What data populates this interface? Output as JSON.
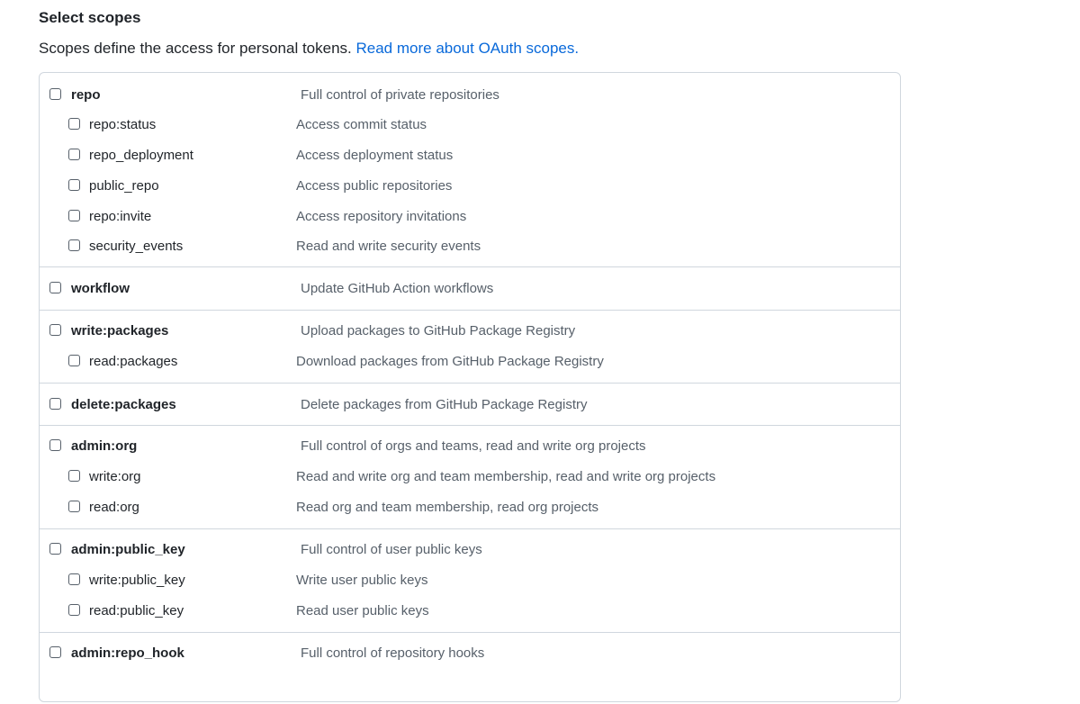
{
  "header": {
    "title": "Select scopes",
    "description": "Scopes define the access for personal tokens.",
    "link": "Read more about OAuth scopes."
  },
  "scopes": [
    {
      "name": "repo",
      "desc": "Full control of private repositories",
      "children": [
        {
          "name": "repo:status",
          "desc": "Access commit status"
        },
        {
          "name": "repo_deployment",
          "desc": "Access deployment status"
        },
        {
          "name": "public_repo",
          "desc": "Access public repositories"
        },
        {
          "name": "repo:invite",
          "desc": "Access repository invitations"
        },
        {
          "name": "security_events",
          "desc": "Read and write security events"
        }
      ]
    },
    {
      "name": "workflow",
      "desc": "Update GitHub Action workflows",
      "children": []
    },
    {
      "name": "write:packages",
      "desc": "Upload packages to GitHub Package Registry",
      "children": [
        {
          "name": "read:packages",
          "desc": "Download packages from GitHub Package Registry"
        }
      ]
    },
    {
      "name": "delete:packages",
      "desc": "Delete packages from GitHub Package Registry",
      "children": []
    },
    {
      "name": "admin:org",
      "desc": "Full control of orgs and teams, read and write org projects",
      "children": [
        {
          "name": "write:org",
          "desc": "Read and write org and team membership, read and write org projects"
        },
        {
          "name": "read:org",
          "desc": "Read org and team membership, read org projects"
        }
      ]
    },
    {
      "name": "admin:public_key",
      "desc": "Full control of user public keys",
      "children": [
        {
          "name": "write:public_key",
          "desc": "Write user public keys"
        },
        {
          "name": "read:public_key",
          "desc": "Read user public keys"
        }
      ]
    },
    {
      "name": "admin:repo_hook",
      "desc": "Full control of repository hooks",
      "children": []
    }
  ]
}
